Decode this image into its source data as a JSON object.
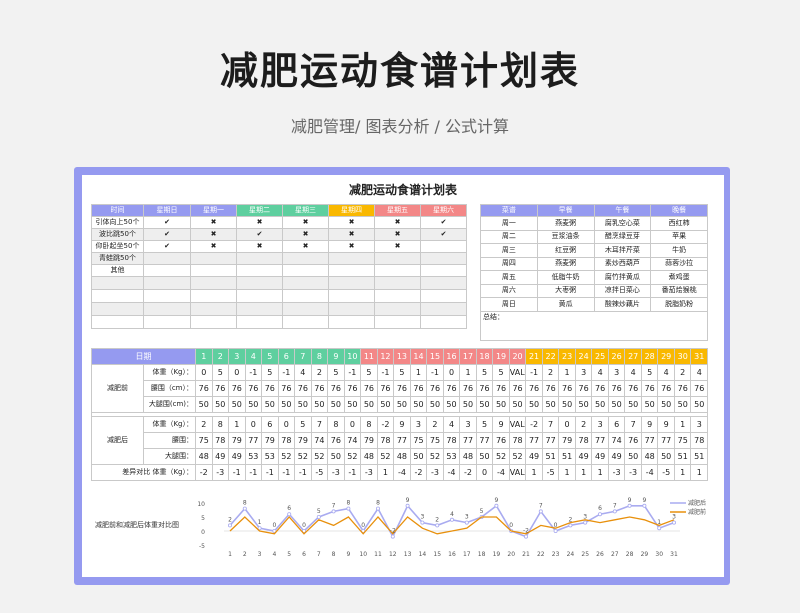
{
  "title": "减肥运动食谱计划表",
  "subtitle": "减肥管理/  图表分析  / 公式计算",
  "sheet": {
    "title": "减肥运动食谱计划表",
    "exercise": {
      "headers": [
        "时间",
        "星期日",
        "星期一",
        "星期二",
        "星期三",
        "星期四",
        "星期五",
        "星期六"
      ],
      "header_colors": [
        "#959af0",
        "#959af0",
        "#959af0",
        "#5ecf9f",
        "#5ecf9f",
        "#f9b800",
        "#f38787",
        "#f38787"
      ],
      "rows": [
        [
          "引体向上50个",
          "✔",
          "✖",
          "✖",
          "✖",
          "✖",
          "✖",
          "✔"
        ],
        [
          "波比跳50个",
          "✔",
          "✖",
          "✔",
          "✖",
          "✖",
          "✖",
          "✔"
        ],
        [
          "仰卧起坐50个",
          "✔",
          "✖",
          "✖",
          "✖",
          "✖",
          "✖",
          ""
        ],
        [
          "青蛙跳50个",
          "",
          "",
          "",
          "",
          "",
          "",
          ""
        ],
        [
          "其他",
          "",
          "",
          "",
          "",
          "",
          "",
          ""
        ],
        [
          "",
          "",
          "",
          "",
          "",
          "",
          "",
          ""
        ],
        [
          "",
          "",
          "",
          "",
          "",
          "",
          "",
          ""
        ],
        [
          "",
          "",
          "",
          "",
          "",
          "",
          "",
          ""
        ],
        [
          "",
          "",
          "",
          "",
          "",
          "",
          "",
          ""
        ]
      ]
    },
    "meals": {
      "headers": [
        "菜谱",
        "早餐",
        "午餐",
        "晚餐"
      ],
      "rows": [
        [
          "周一",
          "燕麦粥",
          "腐乳空心菜",
          "西红柿"
        ],
        [
          "周二",
          "豆浆油条",
          "醋烹绿豆芽",
          "苹果"
        ],
        [
          "周三",
          "红豆粥",
          "木耳拌芹菜",
          "牛奶"
        ],
        [
          "周四",
          "燕麦粥",
          "素炒西葫芦",
          "蒜蓉沙拉"
        ],
        [
          "周五",
          "低脂牛奶",
          "腐竹拌黄瓜",
          "煮鸡蛋"
        ],
        [
          "周六",
          "大枣粥",
          "凉拌日菜心",
          "番茄烩猴桃"
        ],
        [
          "周日",
          "黄瓜",
          "酸辣炒藕片",
          "脱脂奶粉"
        ]
      ],
      "summary_label": "总结："
    },
    "daily": {
      "date_label": "日期",
      "days": [
        "1",
        "2",
        "3",
        "4",
        "5",
        "6",
        "7",
        "8",
        "9",
        "10",
        "11",
        "12",
        "13",
        "14",
        "15",
        "16",
        "17",
        "18",
        "19",
        "20",
        "21",
        "22",
        "23",
        "24",
        "25",
        "26",
        "27",
        "28",
        "29",
        "30",
        "31"
      ],
      "before_label": "减肥前",
      "after_label": "减肥后",
      "weight_label": "体重（Kg）：",
      "waist_label": "腰围（cm）：",
      "thigh_label": "大腿围(cm)：",
      "waist_label2": "腰围：",
      "thigh_label2": "大腿围：",
      "diff_label": "差异对比 体重（Kg）：",
      "before_weight": [
        "0",
        "5",
        "0",
        "-1",
        "5",
        "-1",
        "4",
        "2",
        "5",
        "-1",
        "5",
        "-1",
        "5",
        "1",
        "-1",
        "0",
        "1",
        "5",
        "5",
        "VALU",
        "-1",
        "2",
        "1",
        "3",
        "4",
        "3",
        "4",
        "5",
        "4",
        "2",
        "4"
      ],
      "before_waist": [
        "76",
        "76",
        "76",
        "76",
        "76",
        "76",
        "76",
        "76",
        "76",
        "76",
        "76",
        "76",
        "76",
        "76",
        "76",
        "76",
        "76",
        "76",
        "76",
        "76",
        "76",
        "76",
        "76",
        "76",
        "76",
        "76",
        "76",
        "76",
        "76",
        "76",
        "76"
      ],
      "before_thigh": [
        "50",
        "50",
        "50",
        "50",
        "50",
        "50",
        "50",
        "50",
        "50",
        "50",
        "50",
        "50",
        "50",
        "50",
        "50",
        "50",
        "50",
        "50",
        "50",
        "50",
        "50",
        "50",
        "50",
        "50",
        "50",
        "50",
        "50",
        "50",
        "50",
        "50",
        "50"
      ],
      "after_weight": [
        "2",
        "8",
        "1",
        "0",
        "6",
        "0",
        "5",
        "7",
        "8",
        "0",
        "8",
        "-2",
        "9",
        "3",
        "2",
        "4",
        "3",
        "5",
        "9",
        "VALU",
        "-2",
        "7",
        "0",
        "2",
        "3",
        "6",
        "7",
        "9",
        "9",
        "1",
        "3"
      ],
      "after_waist": [
        "75",
        "78",
        "79",
        "77",
        "79",
        "78",
        "79",
        "74",
        "76",
        "74",
        "79",
        "78",
        "77",
        "75",
        "75",
        "78",
        "77",
        "77",
        "76",
        "78",
        "77",
        "77",
        "79",
        "78",
        "77",
        "74",
        "76",
        "77",
        "77",
        "75",
        "78"
      ],
      "after_thigh": [
        "48",
        "49",
        "49",
        "53",
        "53",
        "52",
        "52",
        "52",
        "50",
        "52",
        "48",
        "52",
        "48",
        "50",
        "52",
        "53",
        "48",
        "50",
        "52",
        "52",
        "49",
        "51",
        "51",
        "49",
        "49",
        "49",
        "50",
        "48",
        "50",
        "51",
        "51"
      ],
      "diff_weight": [
        "-2",
        "-3",
        "-1",
        "-1",
        "-1",
        "-1",
        "-1",
        "-5",
        "-3",
        "-1",
        "-3",
        "1",
        "-4",
        "-2",
        "-3",
        "-4",
        "-2",
        "0",
        "-4",
        "VALU",
        "1",
        "-5",
        "1",
        "1",
        "1",
        "-3",
        "-3",
        "-4",
        "-5",
        "1",
        "1"
      ]
    },
    "chart_label": "减肥前和减肥后体重对比图"
  },
  "chart_data": {
    "type": "line",
    "x": [
      1,
      2,
      3,
      4,
      5,
      6,
      7,
      8,
      9,
      10,
      11,
      12,
      13,
      14,
      15,
      16,
      17,
      18,
      19,
      20,
      21,
      22,
      23,
      24,
      25,
      26,
      27,
      28,
      29,
      30,
      31
    ],
    "series": [
      {
        "name": "减肥后",
        "color": "#a9abf0",
        "values": [
          2,
          8,
          1,
          0,
          6,
          0,
          5,
          7,
          8,
          0,
          8,
          -2,
          9,
          3,
          2,
          4,
          3,
          5,
          9,
          0,
          -2,
          7,
          0,
          2,
          3,
          6,
          7,
          9,
          9,
          1,
          3
        ]
      },
      {
        "name": "减肥前",
        "color": "#e8900c",
        "values": [
          0,
          5,
          0,
          -1,
          5,
          -1,
          4,
          2,
          5,
          -1,
          5,
          -1,
          5,
          1,
          -1,
          0,
          1,
          5,
          5,
          0,
          -1,
          2,
          1,
          3,
          4,
          3,
          4,
          5,
          4,
          2,
          4
        ]
      }
    ],
    "yticks": [
      10,
      5,
      0,
      -5
    ],
    "ylim": [
      -5,
      10
    ],
    "legend": "top-right",
    "data_labels": [
      "2",
      "8",
      "1",
      "0",
      "6",
      "0",
      "5",
      "7",
      "8",
      "0",
      "8",
      "-2",
      "9",
      "3",
      "2",
      "4",
      "3",
      "5",
      "9",
      "0",
      "-2",
      "7",
      "0",
      "2",
      "3",
      "6",
      "7",
      "9",
      "9",
      "1",
      "3"
    ]
  }
}
